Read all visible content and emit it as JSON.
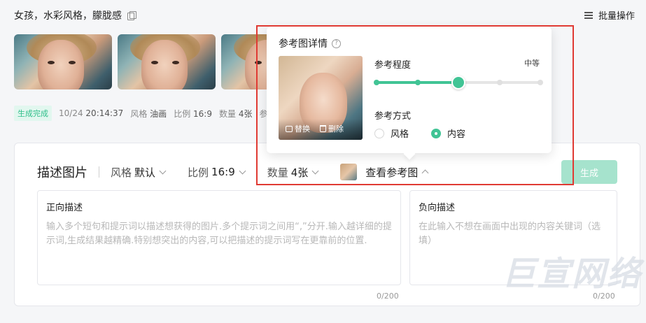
{
  "header": {
    "prompt": "女孩，水彩风格，朦胧感",
    "batch_label": "批量操作"
  },
  "meta": {
    "status": "生成完成",
    "date": "10/24",
    "time": "20:14:37",
    "style_label": "风格",
    "style_value": "油画",
    "ratio_label": "比例",
    "ratio_value": "16:9",
    "count_label": "数量",
    "count_value": "4张",
    "more": "参"
  },
  "panel": {
    "heading": "描述图片",
    "style": {
      "label": "风格",
      "value": "默认"
    },
    "ratio": {
      "label": "比例",
      "value": "16:9"
    },
    "count": {
      "label": "数量",
      "value": "4张"
    },
    "view_ref": "查看参考图",
    "generate": "生成",
    "positive": {
      "label": "正向描述",
      "placeholder": "输入多个短句和提示词以描述想获得的图片.多个提示词之间用“,”分开.输入越详细的提示词,生成结果越精确.特别想突出的内容,可以把描述的提示词写在更靠前的位置.",
      "counter": "0/200"
    },
    "negative": {
      "label": "负向描述",
      "placeholder": "在此输入不想在画面中出现的内容关键词（选填）",
      "counter": "0/200"
    }
  },
  "popover": {
    "title": "参考图详情",
    "replace": "替换",
    "delete": "删除",
    "level_label": "参考程度",
    "level_value": "中等",
    "level_steps": 5,
    "level_index": 2,
    "mode_label": "参考方式",
    "mode_options": [
      "风格",
      "内容"
    ],
    "mode_selected": 1
  },
  "watermark": "巨宣网络",
  "colors": {
    "accent": "#41c495",
    "highlight": "#e03a33",
    "badge_text": "#2fbf8a",
    "generate_btn": "#a6e3cd"
  }
}
